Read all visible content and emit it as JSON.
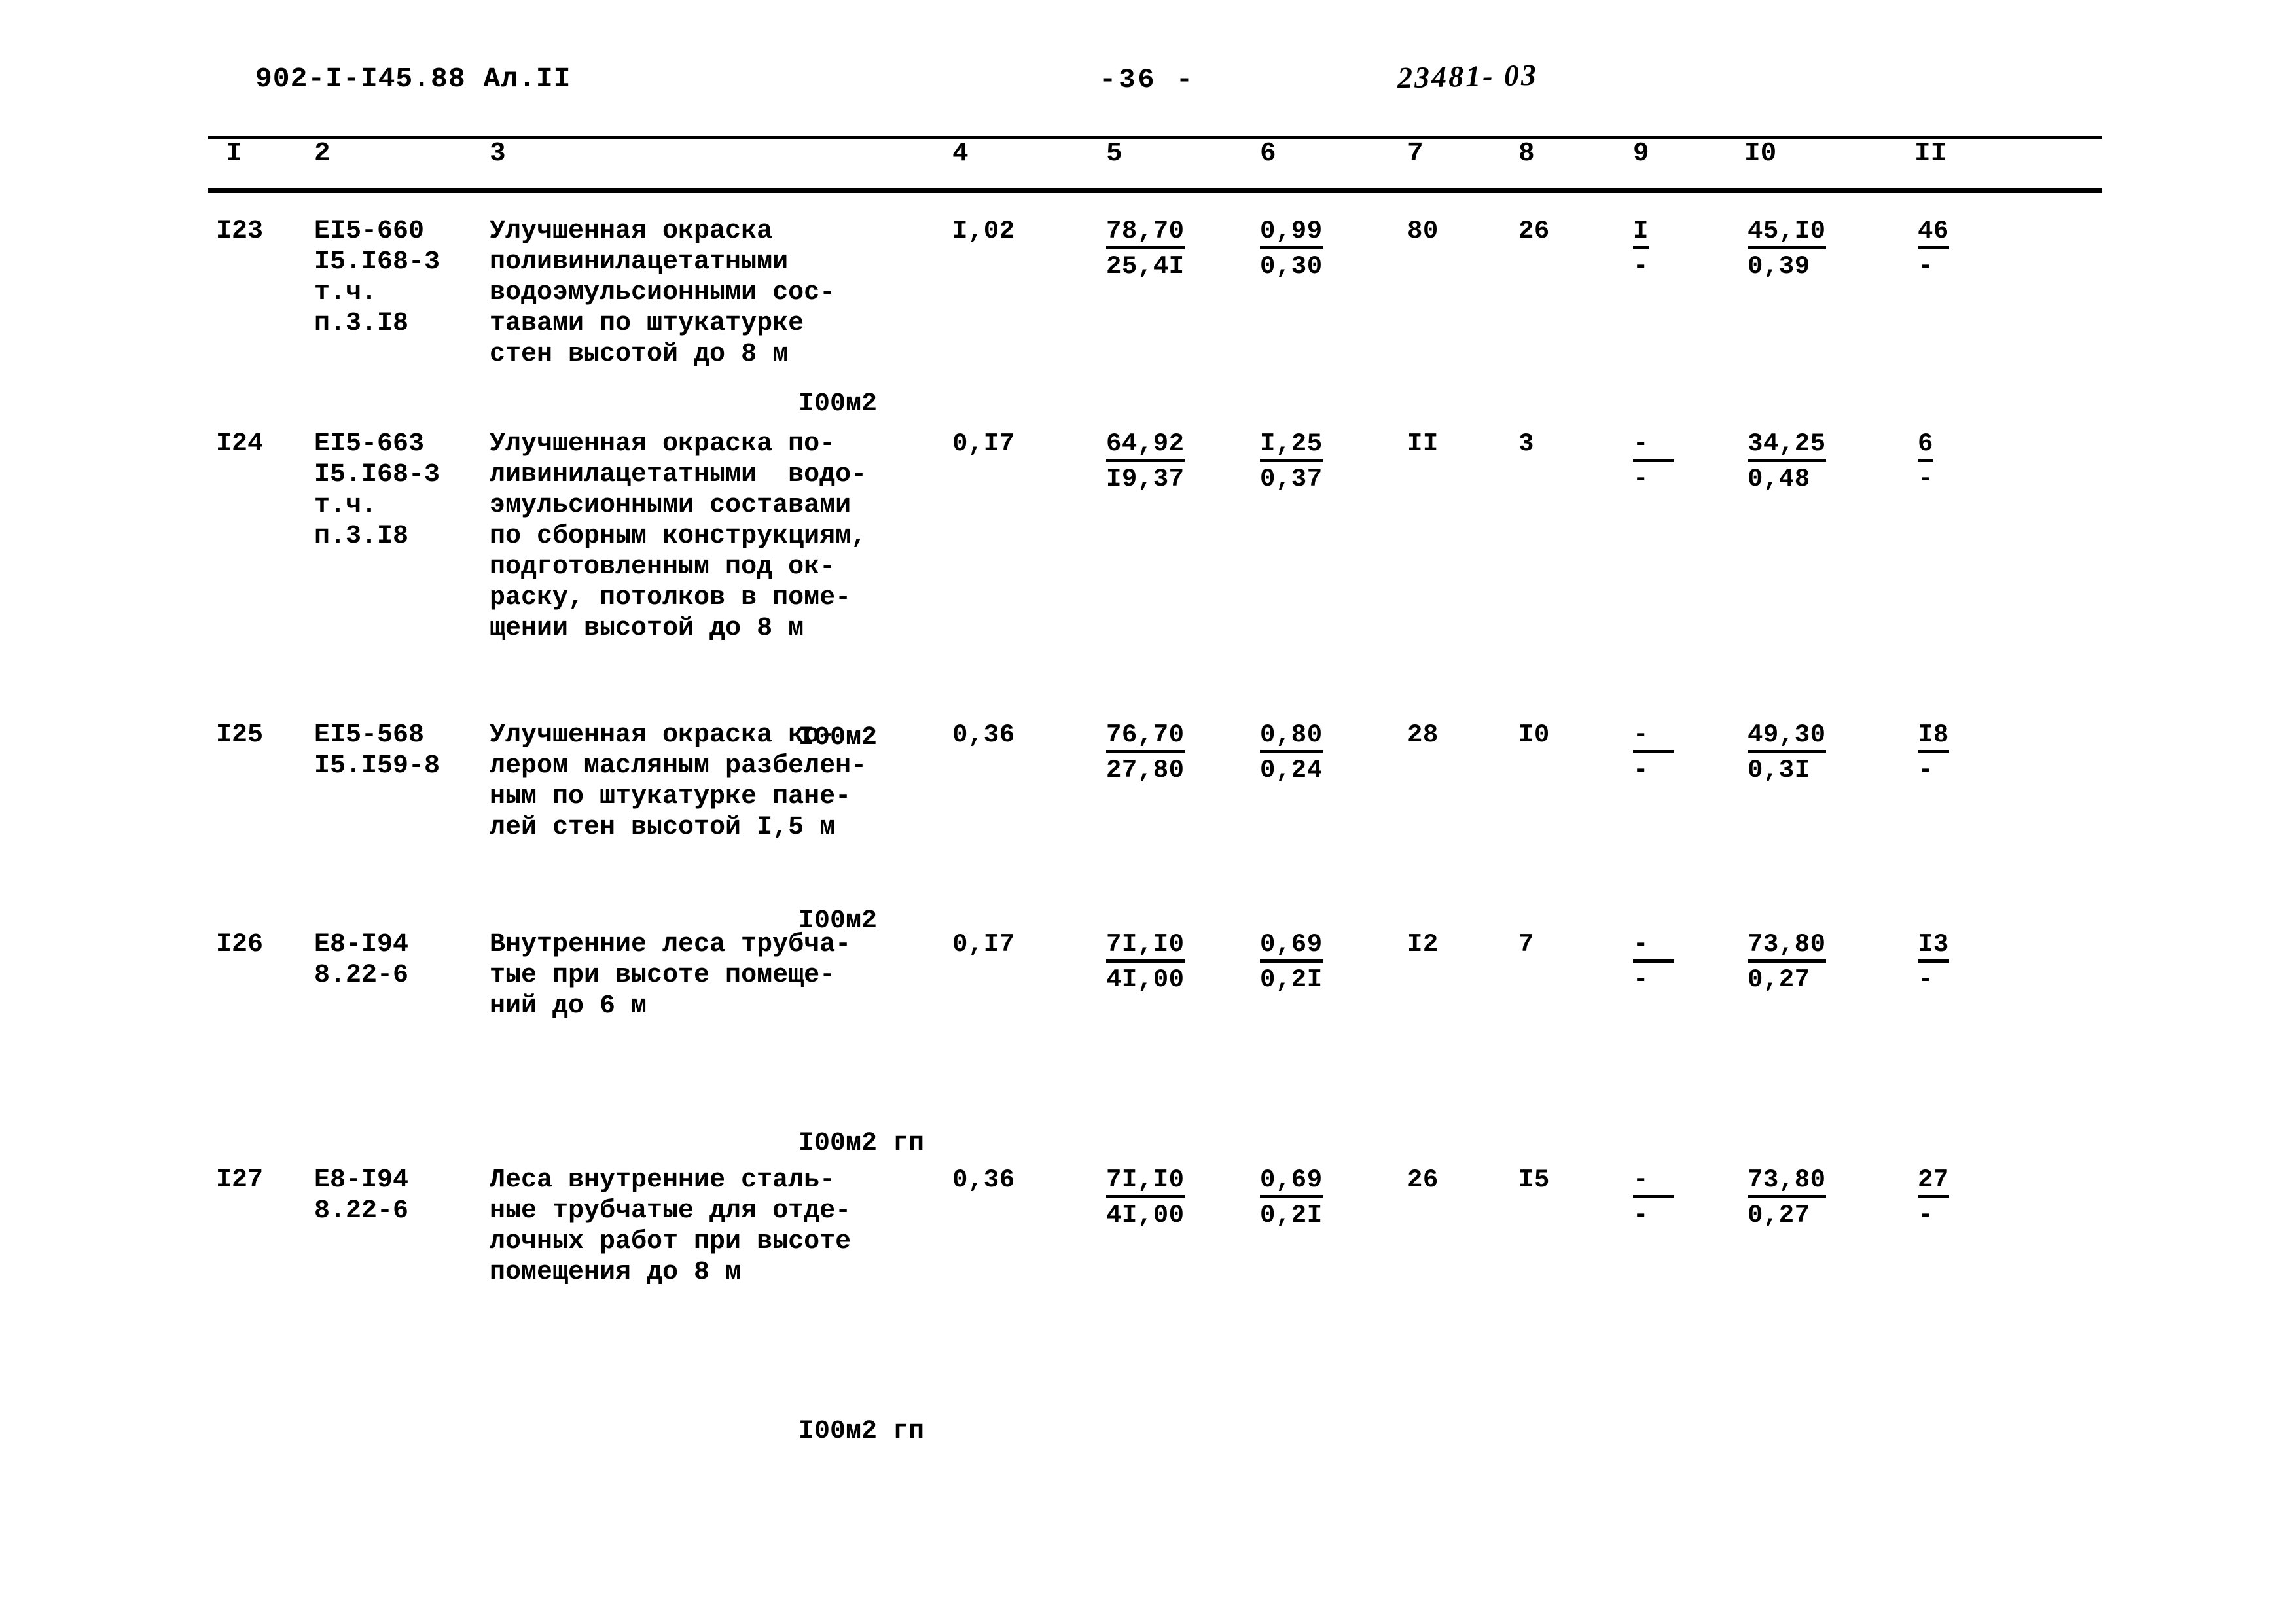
{
  "header": {
    "doc_code": "902-I-I45.88  Ал.II",
    "page_number": "-36  -",
    "hand_annotation": "23481- 03"
  },
  "table": {
    "column_headers": [
      "I",
      "2",
      "3",
      "4",
      "5",
      "6",
      "7",
      "8",
      "9",
      "I0",
      "II"
    ],
    "rows": [
      {
        "num": "I23",
        "code_lines": [
          "EI5-660",
          "I5.I68-3",
          "т.ч.",
          "п.3.I8"
        ],
        "description_lines": [
          "Улучшенная окраска",
          "поливинилацетатными",
          "водоэмульсионными сос-",
          "тавами по штукатурке",
          "стен высотой до 8 м"
        ],
        "unit": "I00м2",
        "c4": "I,02",
        "c5_top": "78,70",
        "c5_bot": "25,4I",
        "c6_top": "0,99",
        "c6_bot": "0,30",
        "c7": "80",
        "c8": "26",
        "c9_top": "I",
        "c9_bot": "-",
        "c10_top": "45,I0",
        "c10_bot": "0,39",
        "c11_top": "46",
        "c11_bot": "-"
      },
      {
        "num": "I24",
        "code_lines": [
          "EI5-663",
          "I5.I68-3",
          "т.ч.",
          "п.3.I8"
        ],
        "description_lines": [
          "Улучшенная окраска по-",
          "ливинилацетатными  водо-",
          "эмульсионными составами",
          "по сборным конструкциям,",
          "подготовленным под ок-",
          "раску, потолков в поме-",
          "щении высотой до 8 м"
        ],
        "unit": "I00м2",
        "c4": "0,I7",
        "c5_top": "64,92",
        "c5_bot": "I9,37",
        "c6_top": "I,25",
        "c6_bot": "0,37",
        "c7": "II",
        "c8": "3",
        "c9_top": "-",
        "c9_bot": "-",
        "c10_top": "34,25",
        "c10_bot": "0,48",
        "c11_top": "6",
        "c11_bot": "-"
      },
      {
        "num": "I25",
        "code_lines": [
          "EI5-568",
          "I5.I59-8"
        ],
        "description_lines": [
          "Улучшенная окраска ко-",
          "лером масляным разбелен-",
          "ным по штукатурке пане-",
          "лей стен высотой I,5 м"
        ],
        "unit": "I00м2",
        "c4": "0,36",
        "c5_top": "76,70",
        "c5_bot": "27,80",
        "c6_top": "0,80",
        "c6_bot": "0,24",
        "c7": "28",
        "c8": "I0",
        "c9_top": "-",
        "c9_bot": "-",
        "c10_top": "49,30",
        "c10_bot": "0,3I",
        "c11_top": "I8",
        "c11_bot": "-"
      },
      {
        "num": "I26",
        "code_lines": [
          "E8-I94",
          "8.22-6"
        ],
        "description_lines": [
          "Внутренние леса трубча-",
          "тые при высоте помеще-",
          "ний до 6 м"
        ],
        "unit": "I00м2 гп",
        "c4": "0,I7",
        "c5_top": "7I,I0",
        "c5_bot": "4I,00",
        "c6_top": "0,69",
        "c6_bot": "0,2I",
        "c7": "I2",
        "c8": "7",
        "c9_top": "-",
        "c9_bot": "-",
        "c10_top": "73,80",
        "c10_bot": "0,27",
        "c11_top": "I3",
        "c11_bot": "-"
      },
      {
        "num": "I27",
        "code_lines": [
          "E8-I94",
          "8.22-6"
        ],
        "description_lines": [
          "Леса внутренние сталь-",
          "ные трубчатые для отде-",
          "лочных работ при высоте",
          "помещения до 8 м"
        ],
        "unit": "I00м2 гп",
        "c4": "0,36",
        "c5_top": "7I,I0",
        "c5_bot": "4I,00",
        "c6_top": "0,69",
        "c6_bot": "0,2I",
        "c7": "26",
        "c8": "I5",
        "c9_top": "-",
        "c9_bot": "-",
        "c10_top": "73,80",
        "c10_bot": "0,27",
        "c11_top": "27",
        "c11_bot": "-"
      }
    ]
  }
}
